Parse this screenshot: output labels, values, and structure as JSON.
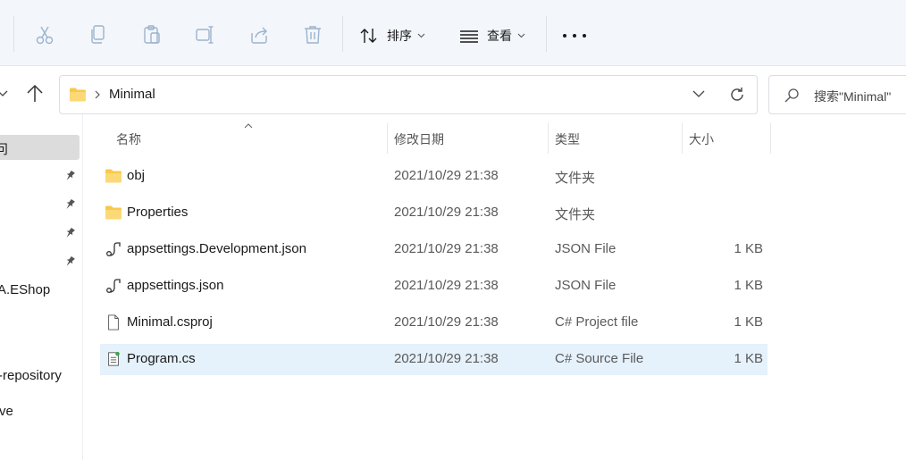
{
  "toolbar": {
    "icons": [
      "cut-icon",
      "copy-icon",
      "paste-icon",
      "rename-icon",
      "share-icon",
      "delete-icon"
    ],
    "sort_label": "排序",
    "view_label": "查看",
    "colors": {
      "enabled_icon": "#1a1a1a",
      "disabled_icon": "#9bb3cd"
    }
  },
  "address": {
    "path": "Minimal",
    "search_placeholder": "搜索\"Minimal\""
  },
  "navpane": {
    "items": [
      {
        "label": "问",
        "selected": true
      },
      {
        "label": "A.EShop"
      },
      {
        "label": "-repository"
      },
      {
        "label": "ve"
      }
    ]
  },
  "columns": {
    "name": "名称",
    "date": "修改日期",
    "type": "类型",
    "size": "大小"
  },
  "files": [
    {
      "icon": "folder-icon",
      "name": "obj",
      "date": "2021/10/29 21:38",
      "type": "文件夹",
      "size": ""
    },
    {
      "icon": "folder-icon",
      "name": "Properties",
      "date": "2021/10/29 21:38",
      "type": "文件夹",
      "size": ""
    },
    {
      "icon": "json-file-icon",
      "name": "appsettings.Development.json",
      "date": "2021/10/29 21:38",
      "type": "JSON File",
      "size": "1 KB"
    },
    {
      "icon": "json-file-icon",
      "name": "appsettings.json",
      "date": "2021/10/29 21:38",
      "type": "JSON File",
      "size": "1 KB"
    },
    {
      "icon": "blank-file-icon",
      "name": "Minimal.csproj",
      "date": "2021/10/29 21:38",
      "type": "C# Project file",
      "size": "1 KB"
    },
    {
      "icon": "cs-file-icon",
      "name": "Program.cs",
      "date": "2021/10/29 21:38",
      "type": "C# Source File",
      "size": "1 KB",
      "selected": true
    }
  ],
  "colors": {
    "selection": "#e5f1fb",
    "folder": "#f8c94a",
    "accent_selected_nav": "#dcdcdc"
  }
}
